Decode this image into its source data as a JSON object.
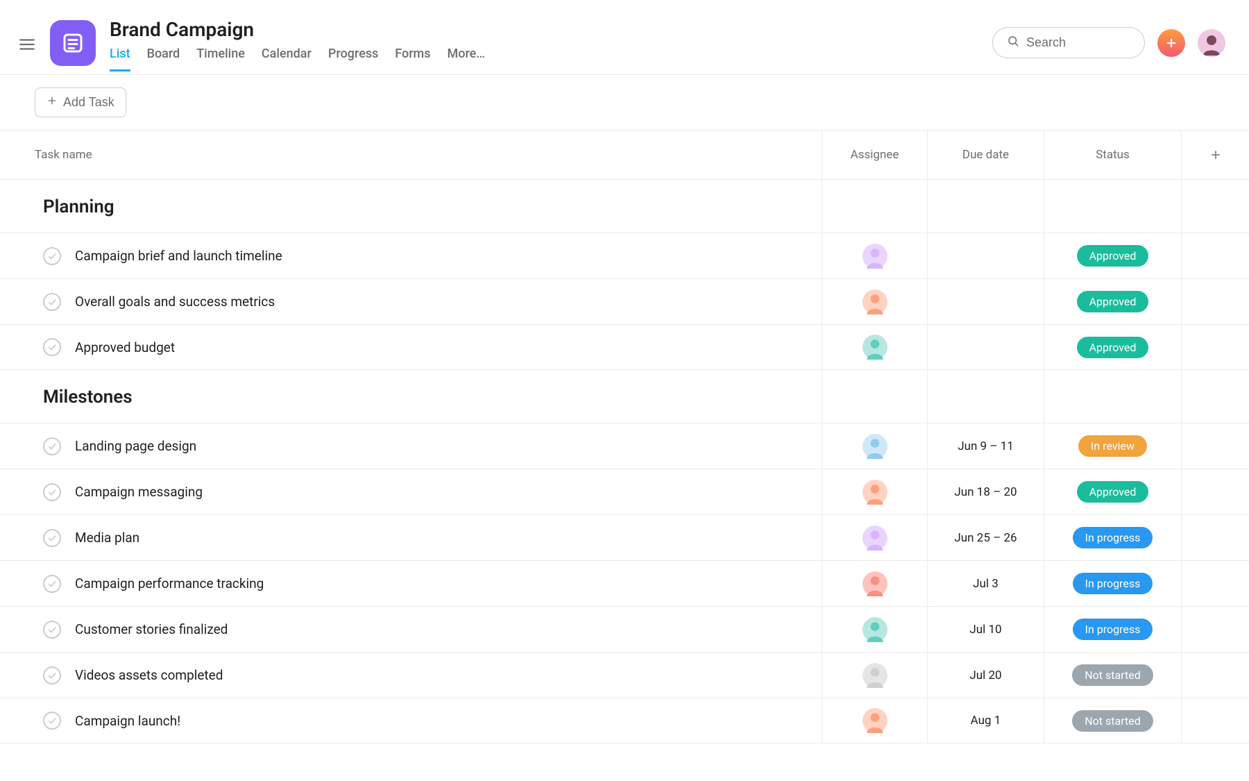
{
  "header": {
    "title": "Brand Campaign",
    "tabs": [
      {
        "label": "List",
        "active": true
      },
      {
        "label": "Board"
      },
      {
        "label": "Timeline"
      },
      {
        "label": "Calendar"
      },
      {
        "label": "Progress"
      },
      {
        "label": "Forms"
      },
      {
        "label": "More…"
      }
    ],
    "search_placeholder": "Search"
  },
  "toolbar": {
    "add_task_label": "Add Task"
  },
  "columns": {
    "task_name": "Task name",
    "assignee": "Assignee",
    "due_date": "Due date",
    "status": "Status"
  },
  "status_colors": {
    "Approved": "#25b e9a",
    "In review": "#f1a33c",
    "In progress": "#2898f0",
    "Not started": "#9ca6af"
  },
  "sections": [
    {
      "title": "Planning",
      "tasks": [
        {
          "name": "Campaign brief and launch timeline",
          "assignee_color1": "#e9d5ff",
          "assignee_color2": "#d8b4fe",
          "due": "",
          "status": "Approved",
          "status_color": "#1abc9c"
        },
        {
          "name": "Overall goals and success metrics",
          "assignee_color1": "#ffd3c2",
          "assignee_color2": "#fca17d",
          "due": "",
          "status": "Approved",
          "status_color": "#1abc9c"
        },
        {
          "name": "Approved budget",
          "assignee_color1": "#b8e6e0",
          "assignee_color2": "#5fcfc0",
          "due": "",
          "status": "Approved",
          "status_color": "#1abc9c"
        }
      ]
    },
    {
      "title": "Milestones",
      "tasks": [
        {
          "name": "Landing page design",
          "assignee_color1": "#cfe8f7",
          "assignee_color2": "#8fccee",
          "due": "Jun 9 – 11",
          "status": "In review",
          "status_color": "#f1a33c"
        },
        {
          "name": "Campaign messaging",
          "assignee_color1": "#ffd3c2",
          "assignee_color2": "#fca17d",
          "due": "Jun 18 – 20",
          "status": "Approved",
          "status_color": "#1abc9c"
        },
        {
          "name": "Media plan",
          "assignee_color1": "#e9d5ff",
          "assignee_color2": "#d8b4fe",
          "due": "Jun 25 – 26",
          "status": "In progress",
          "status_color": "#2898f0"
        },
        {
          "name": "Campaign performance tracking",
          "assignee_color1": "#ffc3bd",
          "assignee_color2": "#f78f84",
          "due": "Jul 3",
          "status": "In progress",
          "status_color": "#2898f0"
        },
        {
          "name": "Customer stories finalized",
          "assignee_color1": "#b8e6e0",
          "assignee_color2": "#5fcfc0",
          "due": "Jul 10",
          "status": "In progress",
          "status_color": "#2898f0"
        },
        {
          "name": "Videos assets completed",
          "assignee_color1": "#e5e5e5",
          "assignee_color2": "#cfcfcf",
          "due": "Jul 20",
          "status": "Not started",
          "status_color": "#9ca6af"
        },
        {
          "name": "Campaign launch!",
          "assignee_color1": "#ffd3c2",
          "assignee_color2": "#fca17d",
          "due": "Aug 1",
          "status": "Not started",
          "status_color": "#9ca6af"
        }
      ]
    }
  ]
}
